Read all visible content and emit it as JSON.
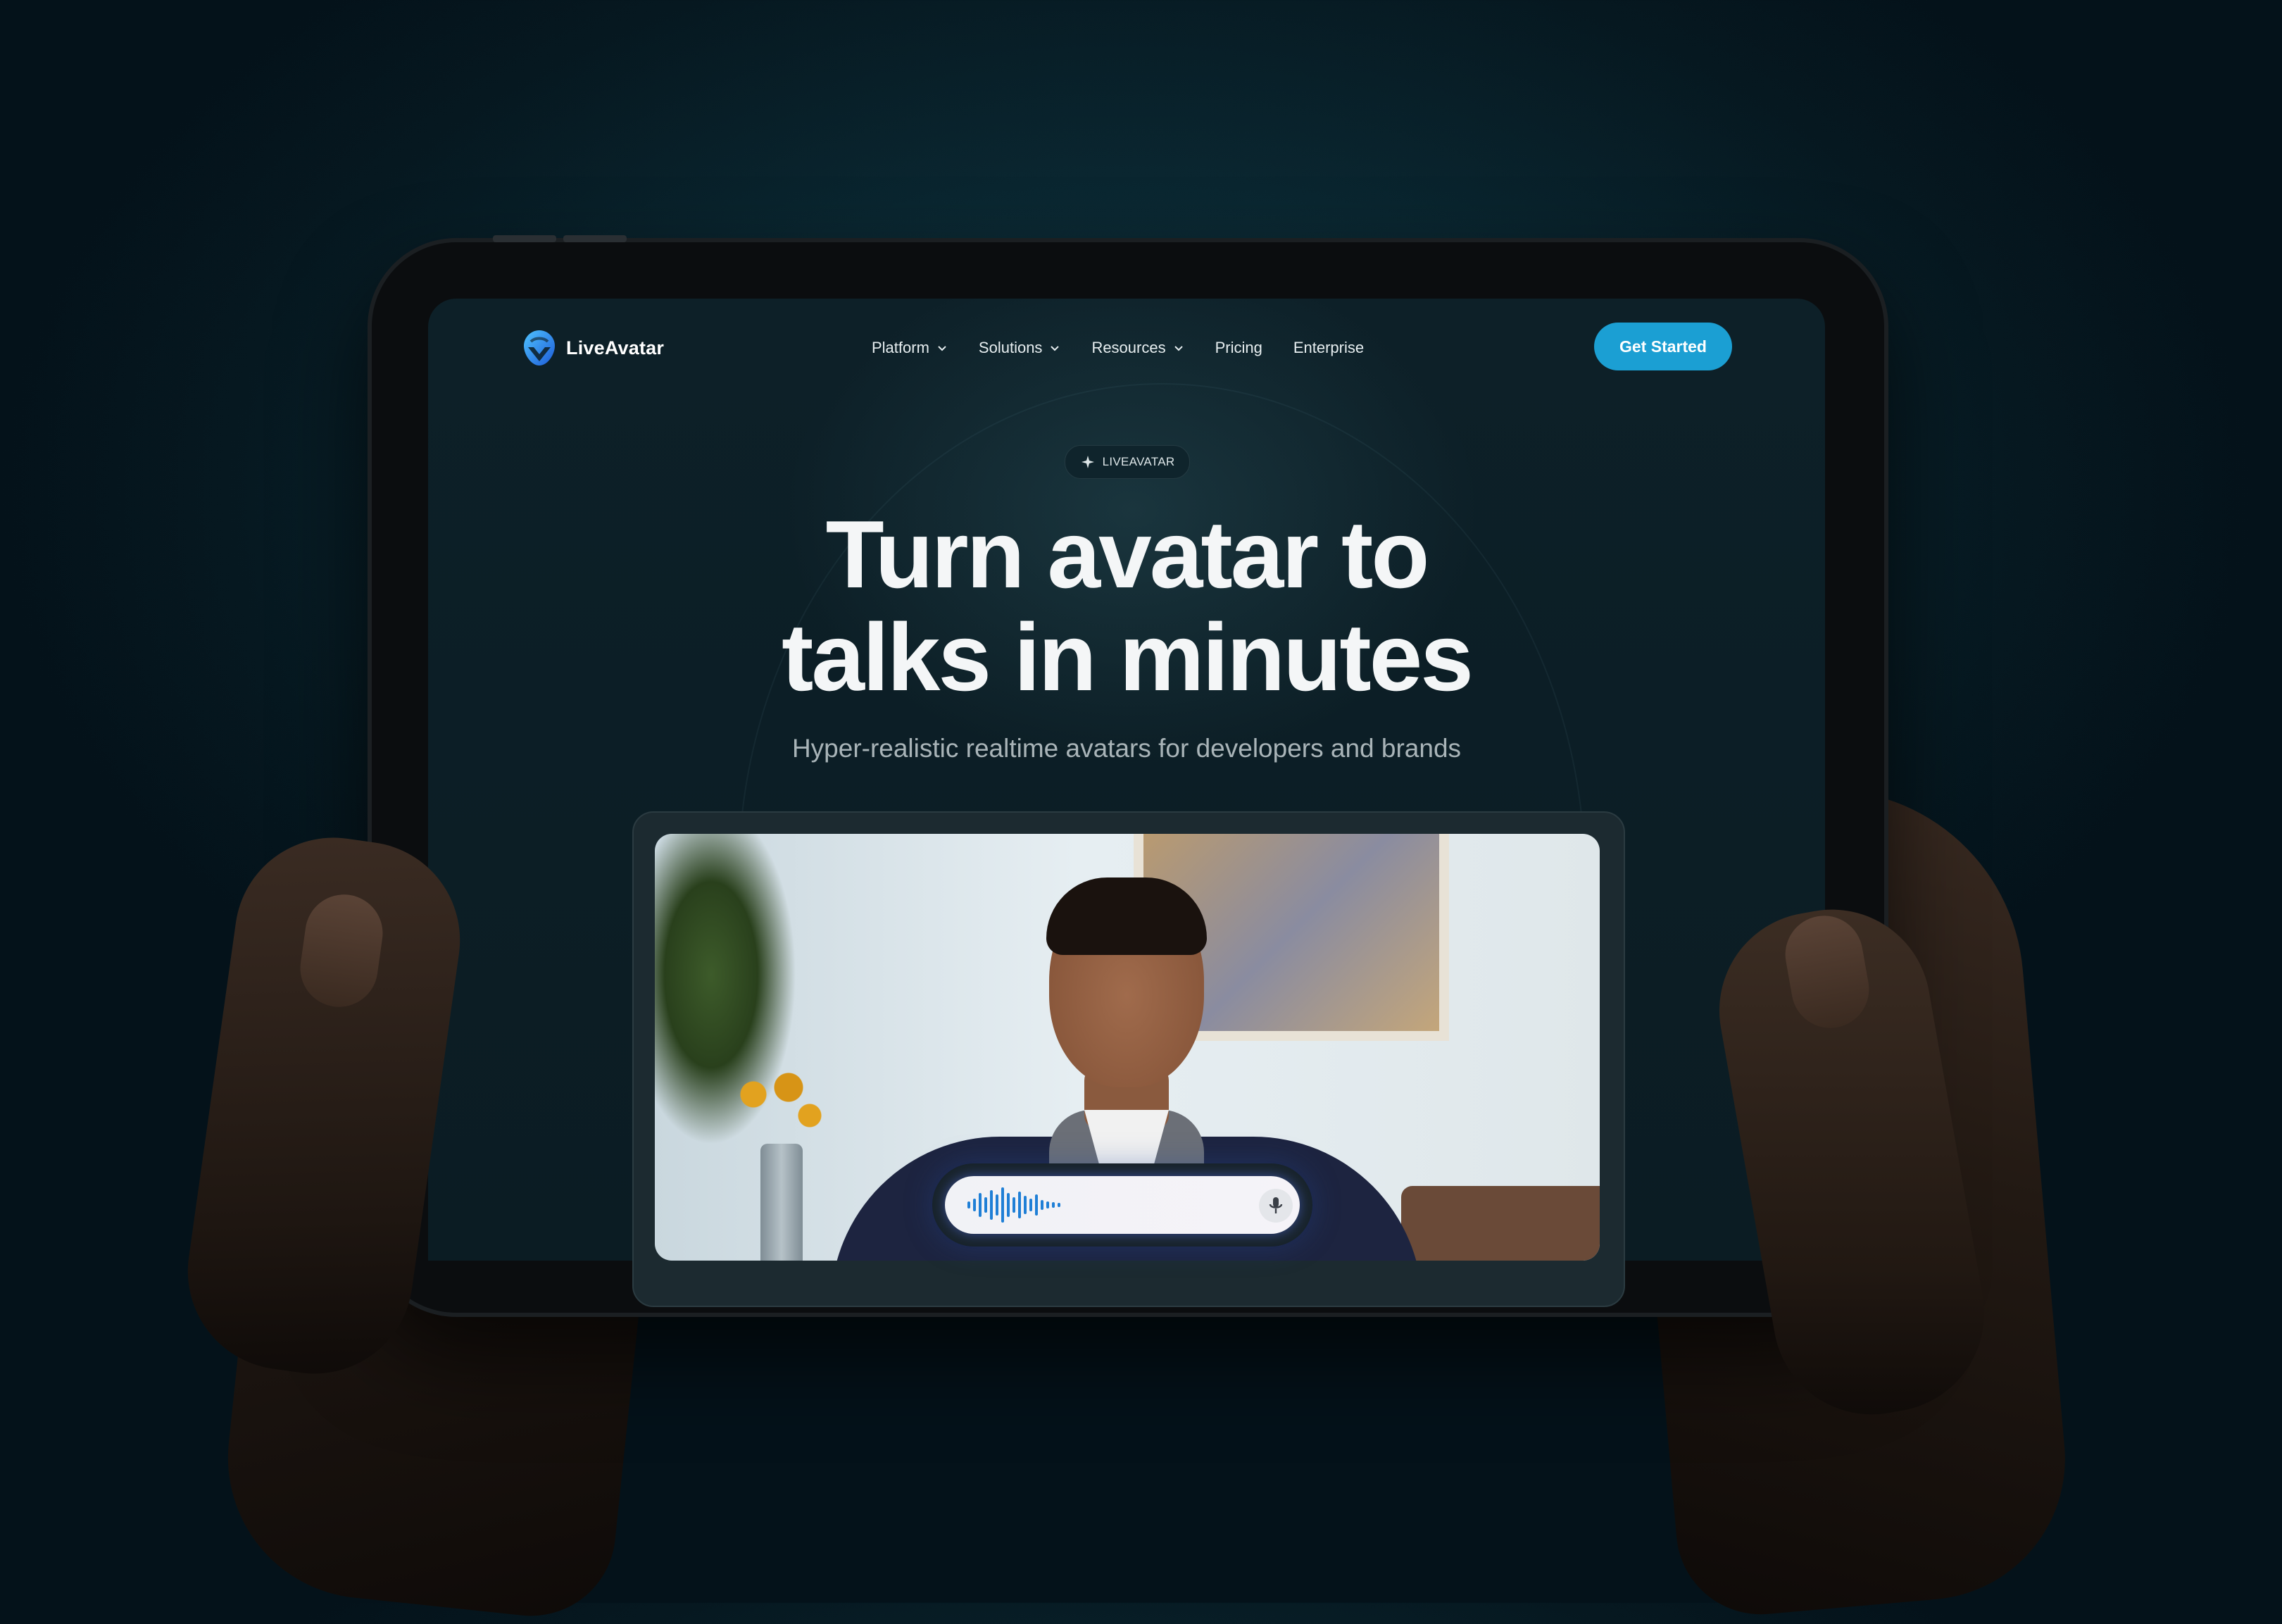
{
  "brand": {
    "name": "LiveAvatar",
    "accent": "#1b9fd3"
  },
  "nav": {
    "items": [
      {
        "label": "Platform",
        "has_dropdown": true
      },
      {
        "label": "Solutions",
        "has_dropdown": true
      },
      {
        "label": "Resources",
        "has_dropdown": true
      },
      {
        "label": "Pricing",
        "has_dropdown": false
      },
      {
        "label": "Enterprise",
        "has_dropdown": false
      }
    ],
    "cta_label": "Get Started"
  },
  "hero": {
    "badge_label": "LIVEAVATAR",
    "headline_line1": "Turn avatar to",
    "headline_line2": "talks in minutes",
    "subheadline": "Hyper-realistic realtime avatars for developers and brands"
  },
  "demo": {
    "icons": [
      "waveform-icon",
      "microphone-icon"
    ]
  },
  "colors": {
    "background": "#0b1c23",
    "text_primary": "#f4f6f7",
    "text_secondary": "#a9b4b8"
  }
}
